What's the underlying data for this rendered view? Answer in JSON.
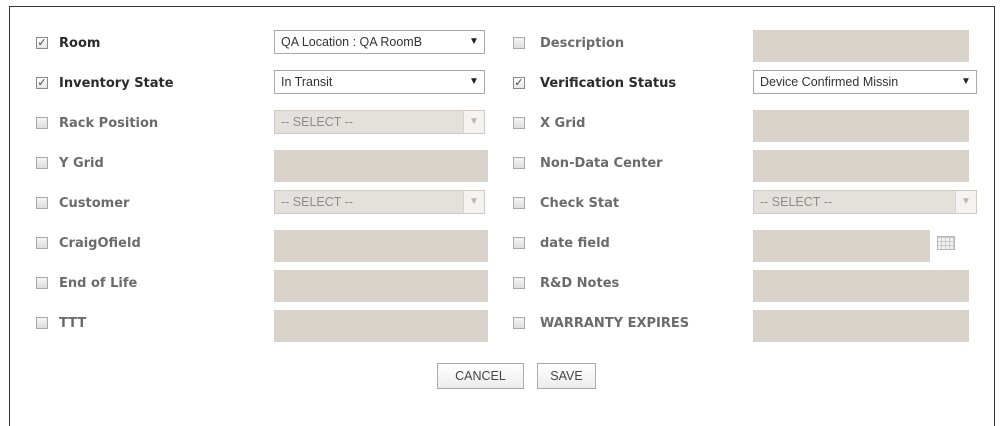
{
  "rows": [
    {
      "left": {
        "checked": true,
        "label": "Room",
        "control": "select",
        "value": "QA Location : QA RoomB",
        "disabled": false
      },
      "right": {
        "checked": false,
        "label": "Description",
        "control": "field"
      }
    },
    {
      "left": {
        "checked": true,
        "label": "Inventory State",
        "control": "select",
        "value": "In Transit",
        "disabled": false
      },
      "right": {
        "checked": true,
        "label": "Verification Status",
        "control": "select",
        "value": "Device Confirmed Missin",
        "disabled": false
      }
    },
    {
      "left": {
        "checked": false,
        "label": "Rack Position",
        "control": "select",
        "value": "-- SELECT --",
        "disabled": true
      },
      "right": {
        "checked": false,
        "label": "X Grid",
        "control": "field"
      }
    },
    {
      "left": {
        "checked": false,
        "label": "Y Grid",
        "control": "field"
      },
      "right": {
        "checked": false,
        "label": "Non-Data Center",
        "control": "field"
      }
    },
    {
      "left": {
        "checked": false,
        "label": "Customer",
        "control": "select",
        "value": "-- SELECT --",
        "disabled": true
      },
      "right": {
        "checked": false,
        "label": "Check Stat",
        "control": "select",
        "value": "-- SELECT --",
        "disabled": true
      }
    },
    {
      "left": {
        "checked": false,
        "label": "CraigOfield",
        "control": "field"
      },
      "right": {
        "checked": false,
        "label": "date field",
        "control": "date",
        "icon": "calendar-icon"
      }
    },
    {
      "left": {
        "checked": false,
        "label": "End of Life",
        "control": "field"
      },
      "right": {
        "checked": false,
        "label": "R&D Notes",
        "control": "field"
      }
    },
    {
      "left": {
        "checked": false,
        "label": "TTT",
        "control": "field"
      },
      "right": {
        "checked": false,
        "label": "WARRANTY EXPIRES",
        "control": "field"
      }
    }
  ],
  "buttons": {
    "cancel": "CANCEL",
    "save": "SAVE"
  },
  "icons": {
    "dropdown": "chevron-down-icon",
    "checkmark": "✓"
  },
  "colors": {
    "field_bg": "#d9d3cc",
    "border": "#333333"
  }
}
